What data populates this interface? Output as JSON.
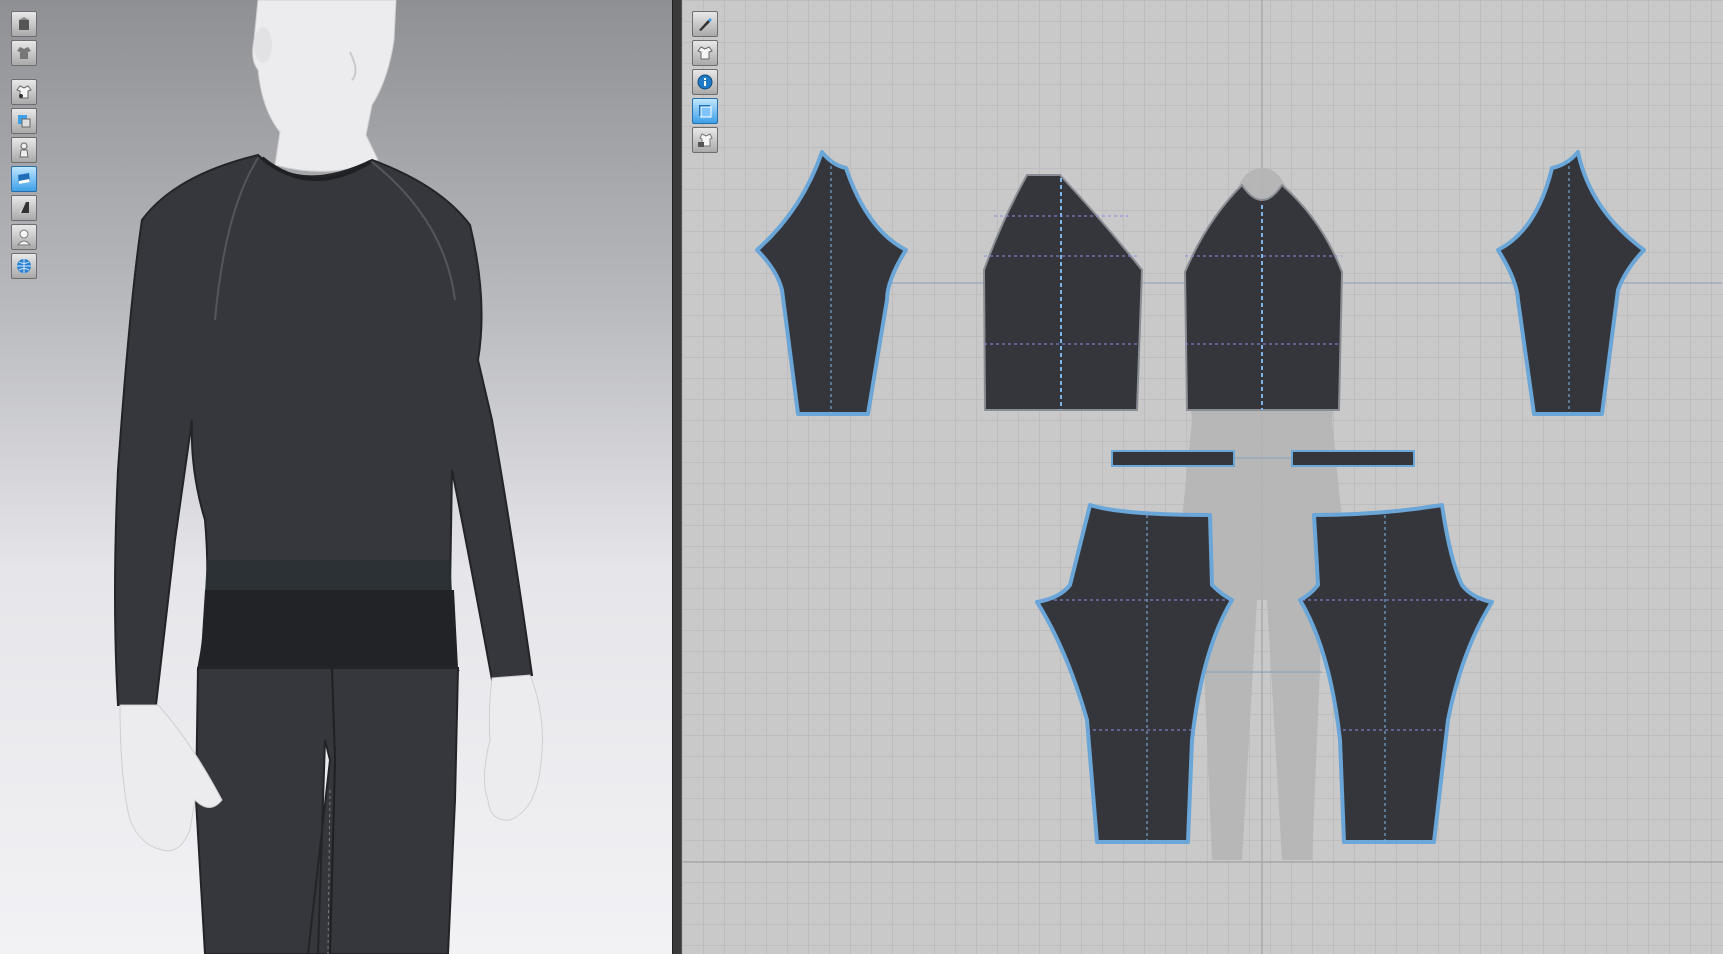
{
  "app": {
    "accent_color": "#6aa6d8",
    "fabric_color": "#34353a"
  },
  "left_toolbar": {
    "tools": [
      {
        "icon": "avatar-box-icon",
        "active": false
      },
      {
        "icon": "garment-shirt-icon",
        "active": false
      },
      {
        "icon": "show-garment-icon",
        "active": false
      },
      {
        "icon": "show-texture-icon",
        "active": false
      },
      {
        "icon": "show-avatar-icon",
        "active": false
      },
      {
        "icon": "fabric-thickness-icon",
        "active": true
      },
      {
        "icon": "surface-shading-icon",
        "active": false
      },
      {
        "icon": "avatar-silhouette-icon",
        "active": false
      },
      {
        "icon": "mesh-globe-icon",
        "active": false
      }
    ]
  },
  "right_toolbar": {
    "tools": [
      {
        "icon": "pen-tool-icon",
        "active": false
      },
      {
        "icon": "show-pattern-icon",
        "active": false
      },
      {
        "icon": "info-icon",
        "active": false
      },
      {
        "icon": "pattern-layer-icon",
        "active": true
      },
      {
        "icon": "lock-pattern-icon",
        "active": false
      }
    ]
  }
}
